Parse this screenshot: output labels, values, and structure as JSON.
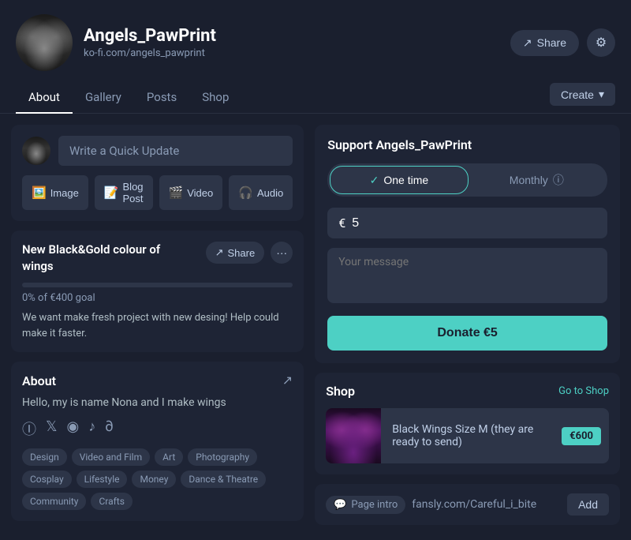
{
  "header": {
    "username": "Angels_PawPrint",
    "url": "ko-fi.com/angels_pawprint",
    "share_label": "Share",
    "create_label": "Create"
  },
  "nav": {
    "tabs": [
      "About",
      "Gallery",
      "Posts",
      "Shop"
    ],
    "active_tab": "About"
  },
  "quick_update": {
    "placeholder": "Write a Quick Update",
    "buttons": [
      {
        "icon": "🖼️",
        "label": "Image"
      },
      {
        "icon": "📝",
        "label": "Blog Post"
      },
      {
        "icon": "🎬",
        "label": "Video"
      },
      {
        "icon": "🎧",
        "label": "Audio"
      }
    ]
  },
  "goal": {
    "title": "New Black&Gold colour of wings",
    "share_label": "Share",
    "progress_percent": 0,
    "progress_text": "0% of €400 goal",
    "description": "We want make fresh project with new desing! Help could make it faster."
  },
  "about": {
    "title": "About",
    "text": "Hello, my is name Nona and I make wings",
    "tags": [
      "Design",
      "Video and Film",
      "Art",
      "Photography",
      "Cosplay",
      "Lifestyle",
      "Money",
      "Dance & Theatre",
      "Community",
      "Crafts"
    ]
  },
  "support": {
    "title": "Support Angels_PawPrint",
    "one_time_label": "One time",
    "monthly_label": "Monthly",
    "amount": "5",
    "currency_symbol": "€",
    "message_placeholder": "Your message",
    "donate_label": "Donate €5"
  },
  "shop": {
    "title": "Shop",
    "go_to_shop_label": "Go to Shop",
    "items": [
      {
        "name": "Black Wings Size M (they are ready to send)",
        "price": "€600"
      }
    ]
  },
  "page_intro": {
    "bubble_label": "Page intro",
    "url_text": "fansly.com/Careful_i_bite",
    "add_label": "Add"
  },
  "icons": {
    "share": "↗",
    "gear": "⚙",
    "chevron_down": "▾",
    "external_link": "↗",
    "dots": "•••",
    "checkmark": "✓",
    "info": "ⓘ",
    "chat": "💬"
  }
}
